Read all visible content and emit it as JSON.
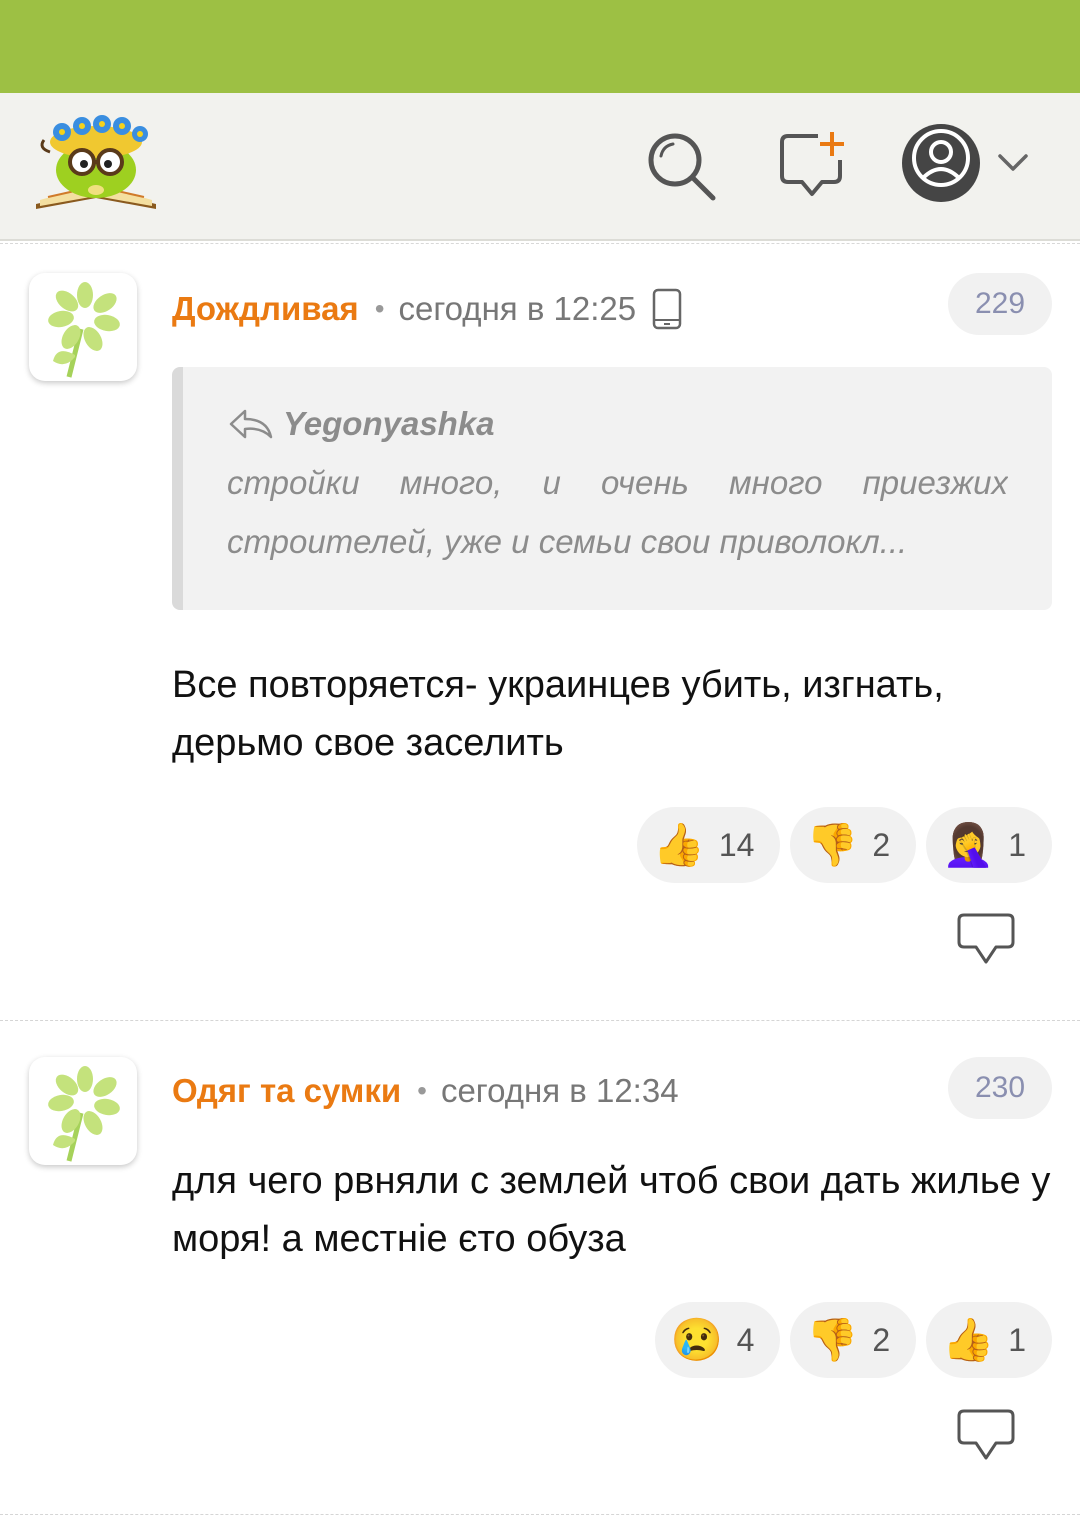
{
  "comments": [
    {
      "author": "Дождливая",
      "separator": "•",
      "time": "сегодня в 12:25",
      "number": "229",
      "has_device_icon": true,
      "quote": {
        "author": "Yegonyashka",
        "text": "стройки много, и очень много приезжих строителей, уже и семьи свои приволокл..."
      },
      "text": "Все повторяется- украинцев убить, изгнать, дерьмо свое заселить",
      "reactions": [
        {
          "icon": "thumbs-up-icon",
          "emoji": "👍",
          "count": "14"
        },
        {
          "icon": "thumbs-down-icon",
          "emoji": "👎",
          "count": "2"
        },
        {
          "icon": "facepalm-icon",
          "emoji": "🤦‍♀️",
          "count": "1"
        }
      ]
    },
    {
      "author": "Одяг та сумки",
      "separator": "•",
      "time": "сегодня в 12:34",
      "number": "230",
      "has_device_icon": false,
      "text": "для чего рвняли с землей чтоб свои дать жилье у моря! а местніе єто обуза",
      "reactions": [
        {
          "icon": "crying-face-icon",
          "emoji": "😢",
          "count": "4"
        },
        {
          "icon": "thumbs-down-icon",
          "emoji": "👎",
          "count": "2"
        },
        {
          "icon": "thumbs-up-icon",
          "emoji": "👍",
          "count": "1"
        }
      ]
    }
  ],
  "colors": {
    "topbar": "#9dc044",
    "author": "#ea7a12",
    "badge_text": "#8a8fb0"
  }
}
